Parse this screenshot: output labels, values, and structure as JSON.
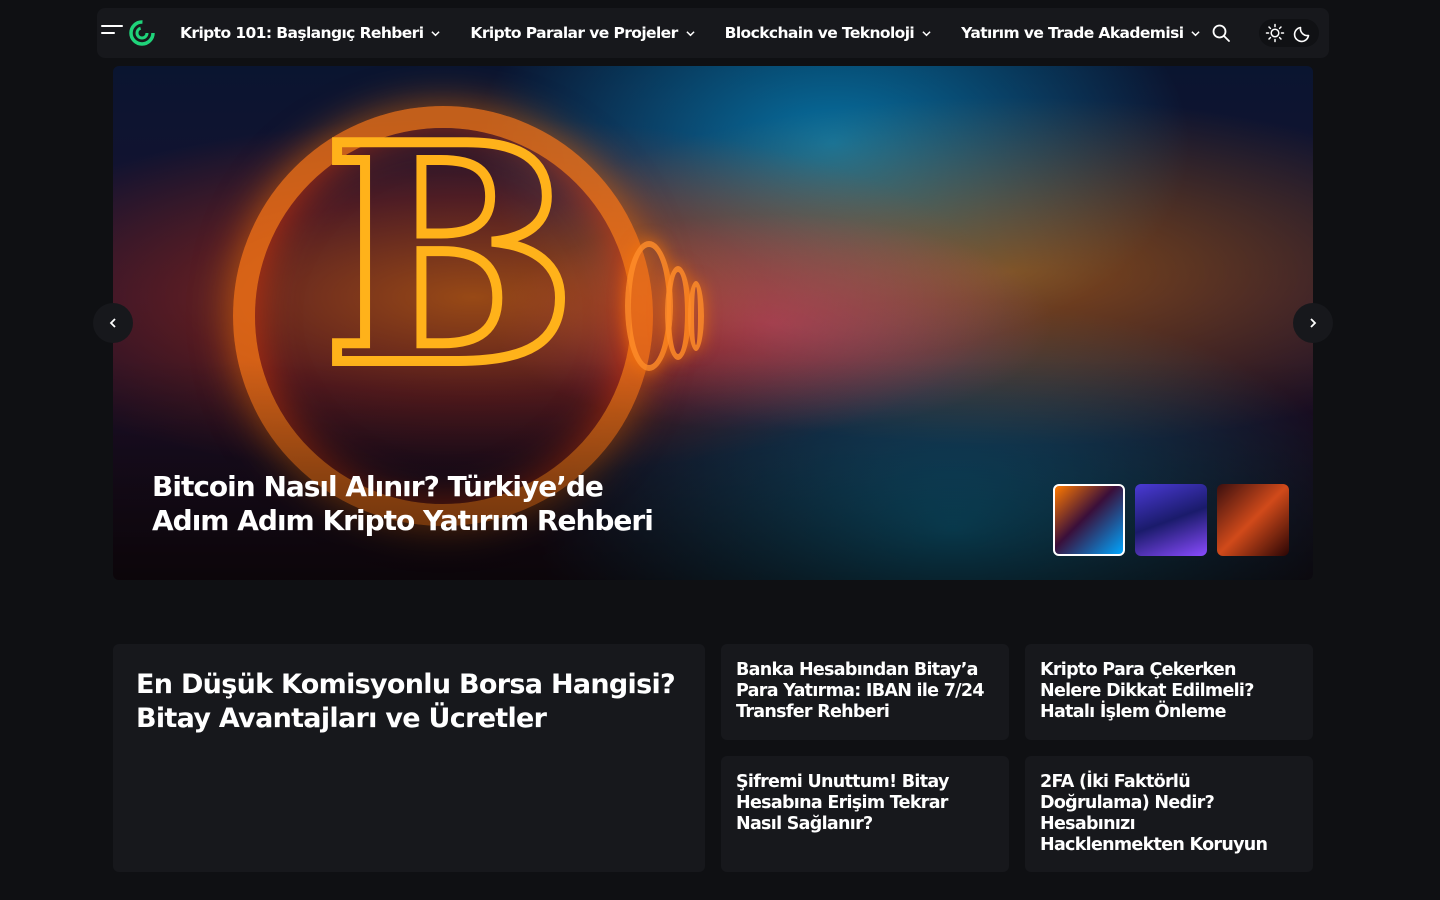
{
  "nav": {
    "items": [
      {
        "label": "Kripto 101: Başlangıç Rehberi"
      },
      {
        "label": "Kripto Paralar ve Projeler"
      },
      {
        "label": "Blockchain ve Teknoloji"
      },
      {
        "label": "Yatırım ve Trade Akademisi"
      }
    ]
  },
  "hero": {
    "title": "Bitcoin Nasıl Alınır? Türkiye’de Adım Adım Kripto Yatırım Rehberi",
    "slide_count": 3,
    "active_slide": 1
  },
  "cards": {
    "featured": "En Düşük Komisyonlu Borsa Hangisi? Bitay Avantajları ve Ücretler",
    "small": [
      "Banka Hesabından Bitay’a Para Yatırma: IBAN ile 7/24 Transfer Rehberi",
      "Kripto Para Çekerken Nelere Dikkat Edilmeli? Hatalı İşlem Önleme",
      "Şifremi Unuttum! Bitay Hesabına Erişim Tekrar Nasıl Sağlanır?",
      "2FA (İki Faktörlü Doğrulama) Nedir? Hesabınızı Hacklenmekten Koruyun"
    ]
  },
  "colors": {
    "background": "#0f1013",
    "panel": "#17181c",
    "logo_green": "#1fd37a"
  },
  "icons": [
    "menu-icon",
    "logo-icon",
    "chevron-down-icon",
    "search-icon",
    "sun-icon",
    "moon-icon",
    "chevron-left-icon",
    "chevron-right-icon"
  ]
}
